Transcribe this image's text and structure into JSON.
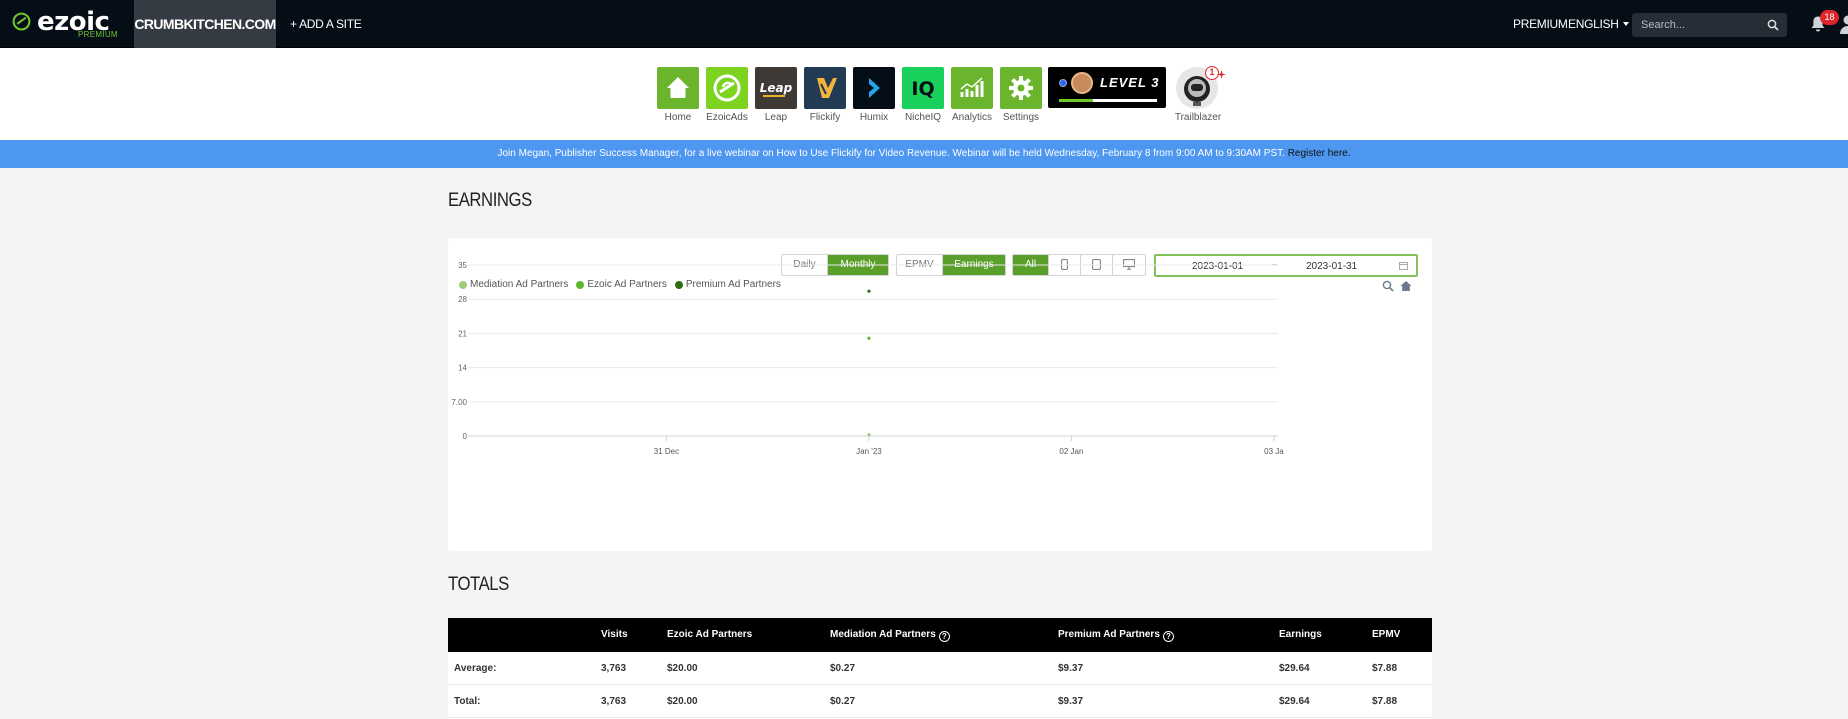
{
  "header": {
    "logo_text": "ezoic",
    "logo_sub": "PREMIUM",
    "site": "CRUMBKITCHEN.COM",
    "add_site": "+ ADD A SITE",
    "premium": "PREMIUM",
    "language": "ENGLISH",
    "search_placeholder": "Search...",
    "notification_count": "18",
    "colors": {
      "bar": "#050d16",
      "accent": "#6cc72e",
      "badge": "#e0262a"
    }
  },
  "apps": [
    {
      "label": "Home",
      "icon": "home-icon",
      "bg": "#6bb52d"
    },
    {
      "label": "EzoicAds",
      "icon": "ezoicads-icon",
      "bg": "#7ed321"
    },
    {
      "label": "Leap",
      "icon": "leap-icon",
      "bg": "#3f3a35"
    },
    {
      "label": "Flickify",
      "icon": "flickify-icon",
      "bg": "#233a55"
    },
    {
      "label": "Humix",
      "icon": "humix-icon",
      "bg": "#050d16"
    },
    {
      "label": "NicheIQ",
      "icon": "nicheiq-icon",
      "bg": "#19d15a"
    },
    {
      "label": "Analytics",
      "icon": "analytics-icon",
      "bg": "#6bb52d"
    },
    {
      "label": "Settings",
      "icon": "gear-icon",
      "bg": "#6bb52d"
    }
  ],
  "level": {
    "text": "LEVEL 3",
    "progress": 0.35
  },
  "trailblazer": {
    "label": "Trailblazer",
    "count": "1"
  },
  "banner": {
    "text": "Join Megan, Publisher Success Manager, for a live webinar on How to Use Flickify for Video Revenue. Webinar will be held Wednesday, February 8 from 9:00 AM to 9:30AM PST. ",
    "link": "Register here."
  },
  "earnings": {
    "title": "EARNINGS",
    "granularity": [
      "Daily",
      "Monthly"
    ],
    "granularity_selected": "Monthly",
    "metric": [
      "EPMV",
      "Earnings"
    ],
    "metric_selected": "Earnings",
    "device": [
      "All",
      "mobile-icon",
      "tablet-icon",
      "desktop-icon"
    ],
    "device_selected": "All",
    "date_from": "2023-01-01",
    "date_to": "2023-01-31",
    "date_sep": "~"
  },
  "chart_data": {
    "type": "scatter",
    "ylim": [
      0,
      35
    ],
    "yticks": [
      "0",
      "7.00",
      "14",
      "21",
      "28",
      "35"
    ],
    "ytick_values": [
      0,
      7,
      14,
      21,
      28,
      35
    ],
    "xticks": [
      "31 Dec",
      "Jan '23",
      "02 Jan",
      "03 Ja"
    ],
    "xtick_values": [
      -1,
      0,
      1,
      2
    ],
    "legend_position": "top-left",
    "grid": true,
    "series": [
      {
        "name": "Mediation Ad Partners",
        "color": "#9ccc7a",
        "x": [
          0
        ],
        "y": [
          0.27
        ]
      },
      {
        "name": "Ezoic Ad Partners",
        "color": "#5cb82a",
        "x": [
          0
        ],
        "y": [
          20.0
        ]
      },
      {
        "name": "Premium Ad Partners",
        "color": "#2e6b12",
        "x": [
          0
        ],
        "y": [
          29.64
        ]
      }
    ]
  },
  "totals": {
    "title": "TOTALS",
    "columns": [
      "Visits",
      "Ezoic Ad Partners",
      "Mediation Ad Partners",
      "Premium Ad Partners",
      "Earnings",
      "EPMV"
    ],
    "rows": [
      {
        "label": "Average:",
        "cells": [
          "3,763",
          "$20.00",
          "$0.27",
          "$9.37",
          "$29.64",
          "$7.88"
        ]
      },
      {
        "label": "Total:",
        "cells": [
          "3,763",
          "$20.00",
          "$0.27",
          "$9.37",
          "$29.64",
          "$7.88"
        ]
      }
    ]
  }
}
